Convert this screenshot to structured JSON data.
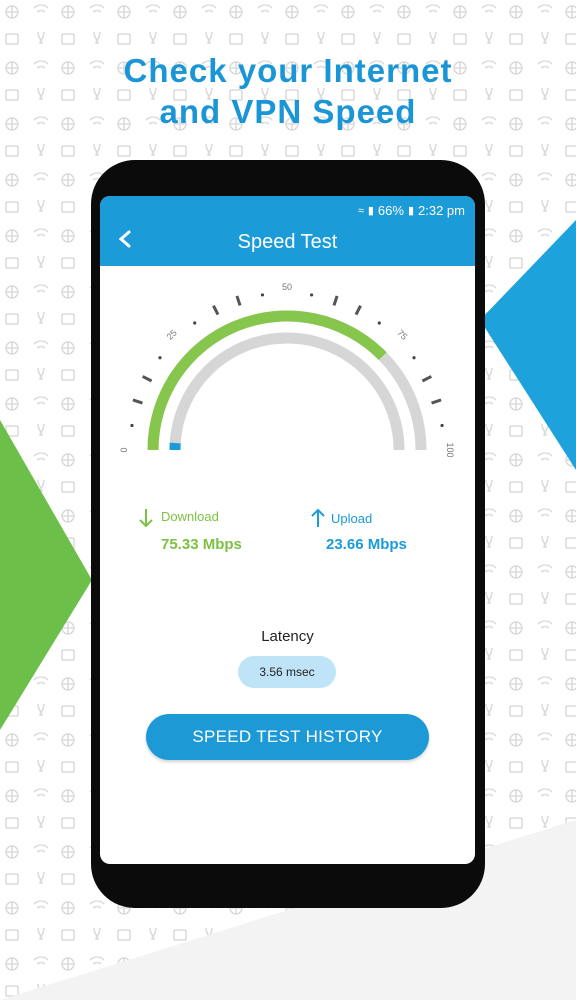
{
  "headline": {
    "line1": "Check your Internet",
    "line2": "and VPN Speed"
  },
  "status_bar": {
    "battery": "66%",
    "time": "2:32 pm"
  },
  "app_bar": {
    "title": "Speed Test"
  },
  "gauge": {
    "min_label": "0",
    "tick_labels": [
      "0",
      "25",
      "50",
      "75",
      "100"
    ],
    "download_fraction": 0.7533,
    "upload_fraction": 0.02
  },
  "download": {
    "label": "Download",
    "value": "75.33 Mbps",
    "color": "#7cc242"
  },
  "upload": {
    "label": "Upload",
    "value": "23.66 Mbps",
    "color": "#1b9bd7"
  },
  "latency": {
    "label": "Latency",
    "value": "3.56 msec"
  },
  "history_button": {
    "label": "SPEED TEST HISTORY"
  },
  "colors": {
    "brand_blue": "#1b9bd7",
    "brand_green": "#6cc04a"
  }
}
